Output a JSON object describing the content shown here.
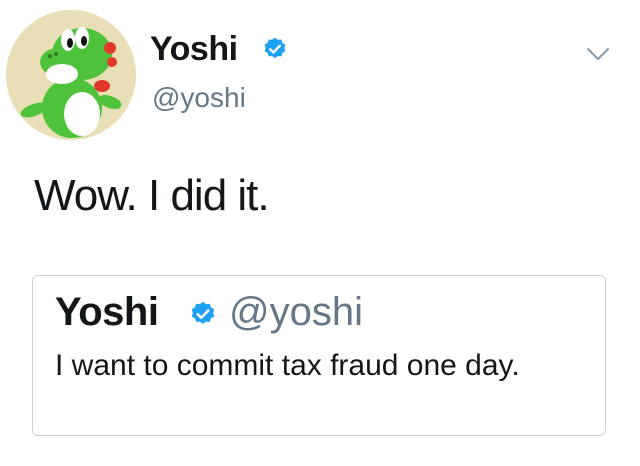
{
  "tweet": {
    "author": {
      "display_name": "Yoshi",
      "handle": "@yoshi",
      "verified": true,
      "avatar": "yoshi-avatar"
    },
    "text": "Wow. I did it.",
    "menu_icon": "chevron-down-icon"
  },
  "quoted_tweet": {
    "display_name": "Yoshi",
    "handle": "@yoshi",
    "verified": true,
    "text": "I want to  commit tax fraud one day."
  },
  "colors": {
    "text": "#14171a",
    "secondary_text": "#657786",
    "verified_badge": "#1da1f2",
    "card_border": "#ccd6dd",
    "avatar_background": "#e8dfb6"
  }
}
